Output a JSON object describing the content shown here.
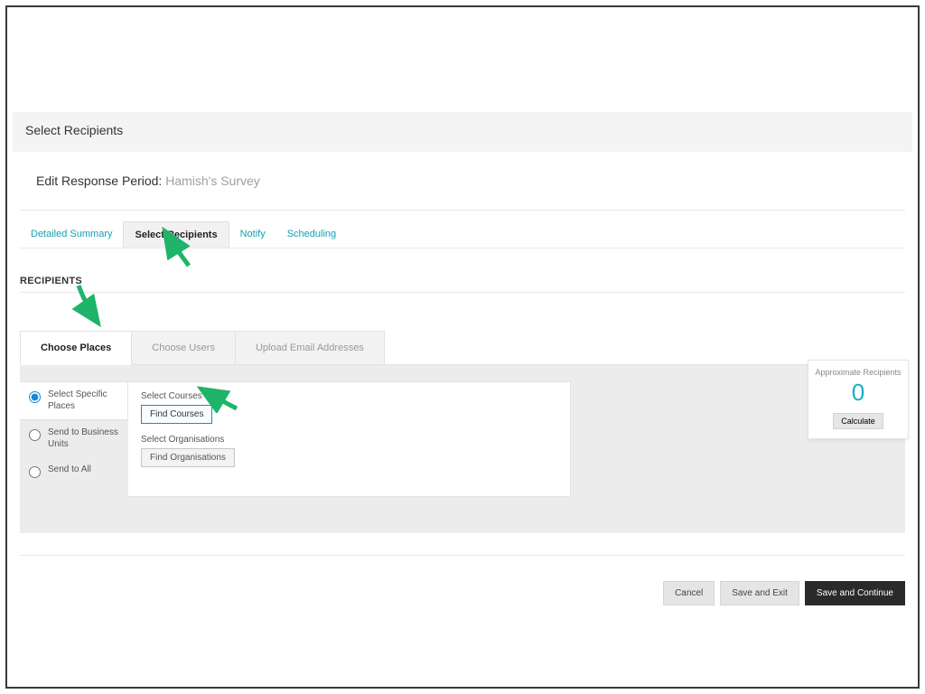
{
  "header": {
    "title": "Select Recipients"
  },
  "card": {
    "title_prefix": "Edit Response Period: ",
    "survey_name": "Hamish's Survey"
  },
  "tabs": {
    "items": [
      {
        "label": "Detailed Summary"
      },
      {
        "label": "Select Recipients"
      },
      {
        "label": "Notify"
      },
      {
        "label": "Scheduling"
      }
    ],
    "active_index": 1
  },
  "section": {
    "title": "RECIPIENTS"
  },
  "subtabs": {
    "items": [
      {
        "label": "Choose Places"
      },
      {
        "label": "Choose Users"
      },
      {
        "label": "Upload Email Addresses"
      }
    ],
    "active_index": 0
  },
  "radio_options": [
    {
      "label": "Select Specific Places",
      "checked": true
    },
    {
      "label": "Send to Business Units",
      "checked": false
    },
    {
      "label": "Send to All",
      "checked": false
    }
  ],
  "controls": {
    "courses_label": "Select Courses",
    "courses_btn": "Find Courses",
    "orgs_label": "Select Organisations",
    "orgs_btn": "Find Organisations"
  },
  "approx": {
    "label": "Approximate Recipients",
    "value": "0",
    "calc_btn": "Calculate"
  },
  "footer": {
    "cancel": "Cancel",
    "save_exit": "Save and Exit",
    "save_continue": "Save and Continue"
  }
}
